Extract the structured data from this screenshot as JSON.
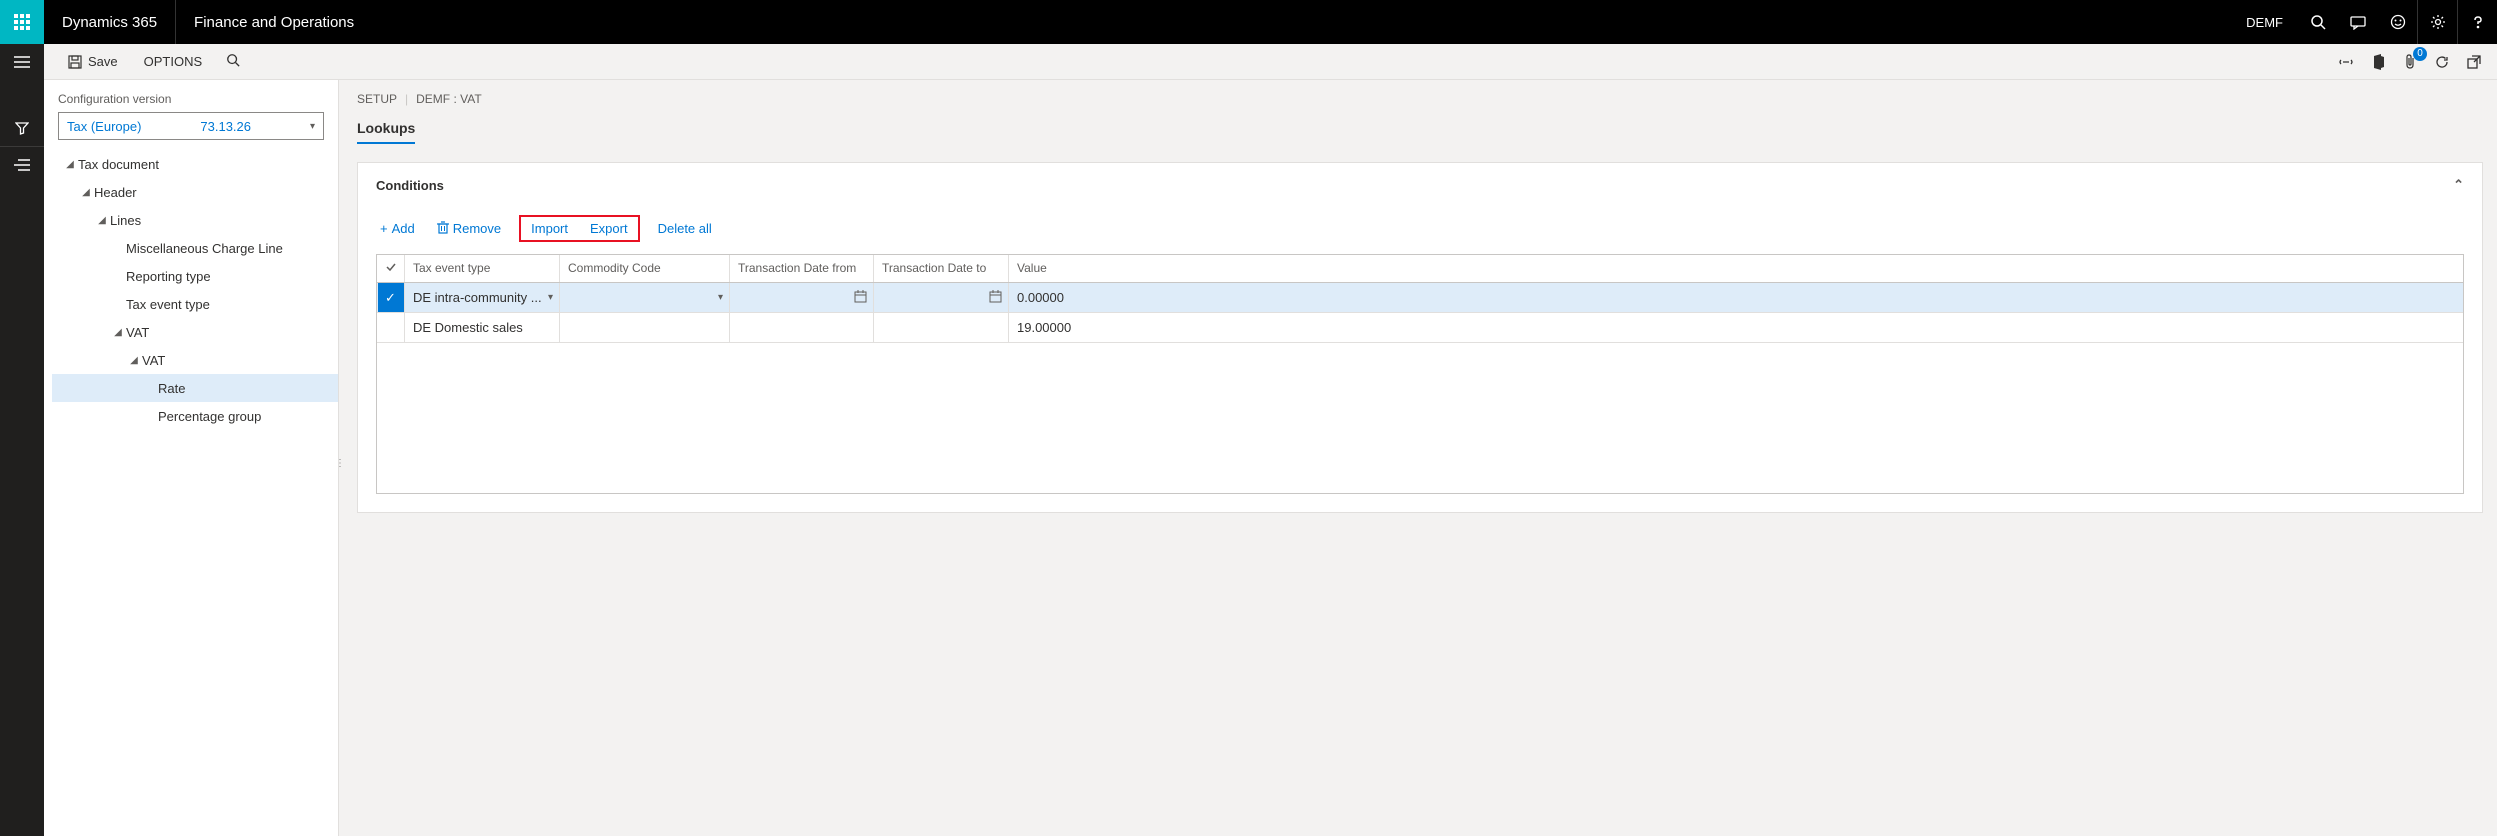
{
  "header": {
    "brand": "Dynamics 365",
    "app": "Finance and Operations",
    "company": "DEMF"
  },
  "actionbar": {
    "save": "Save",
    "options": "OPTIONS",
    "badge_count": "0"
  },
  "sidebar": {
    "config_label": "Configuration version",
    "config_name": "Tax (Europe)",
    "config_version": "73.13.26",
    "tree": {
      "tax_document": "Tax document",
      "header_node": "Header",
      "lines": "Lines",
      "misc_charge": "Miscellaneous Charge Line",
      "reporting_type": "Reporting type",
      "tax_event_type": "Tax event type",
      "vat": "VAT",
      "vat_inner": "VAT",
      "rate": "Rate",
      "percentage_group": "Percentage group"
    }
  },
  "content": {
    "breadcrumb": {
      "a": "SETUP",
      "b": "DEMF : VAT"
    },
    "tab_lookups": "Lookups",
    "panel_title": "Conditions",
    "toolbar": {
      "add": "Add",
      "remove": "Remove",
      "import": "Import",
      "export": "Export",
      "delete_all": "Delete all"
    },
    "grid": {
      "headers": {
        "tax_event_type": "Tax event type",
        "commodity_code": "Commodity Code",
        "trans_from": "Transaction Date from",
        "trans_to": "Transaction Date to",
        "value": "Value"
      },
      "rows": [
        {
          "tax_event_type": "DE intra-community ...",
          "commodity_code": "",
          "trans_from": "",
          "trans_to": "",
          "value": "0.00000",
          "selected": true
        },
        {
          "tax_event_type": "DE Domestic sales",
          "commodity_code": "",
          "trans_from": "",
          "trans_to": "",
          "value": "19.00000",
          "selected": false
        }
      ]
    }
  }
}
